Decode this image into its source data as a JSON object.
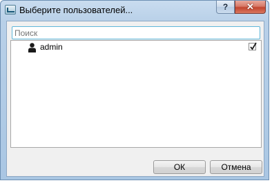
{
  "window": {
    "title": "Выберите пользователей...",
    "help_label": "?",
    "close_label": "✕"
  },
  "search": {
    "placeholder": "Поиск",
    "value": ""
  },
  "list": {
    "items": [
      {
        "label": "admin",
        "icon": "user-icon",
        "checked": true
      }
    ]
  },
  "buttons": {
    "ok_label": "ОК",
    "cancel_label": "Отмена"
  }
}
